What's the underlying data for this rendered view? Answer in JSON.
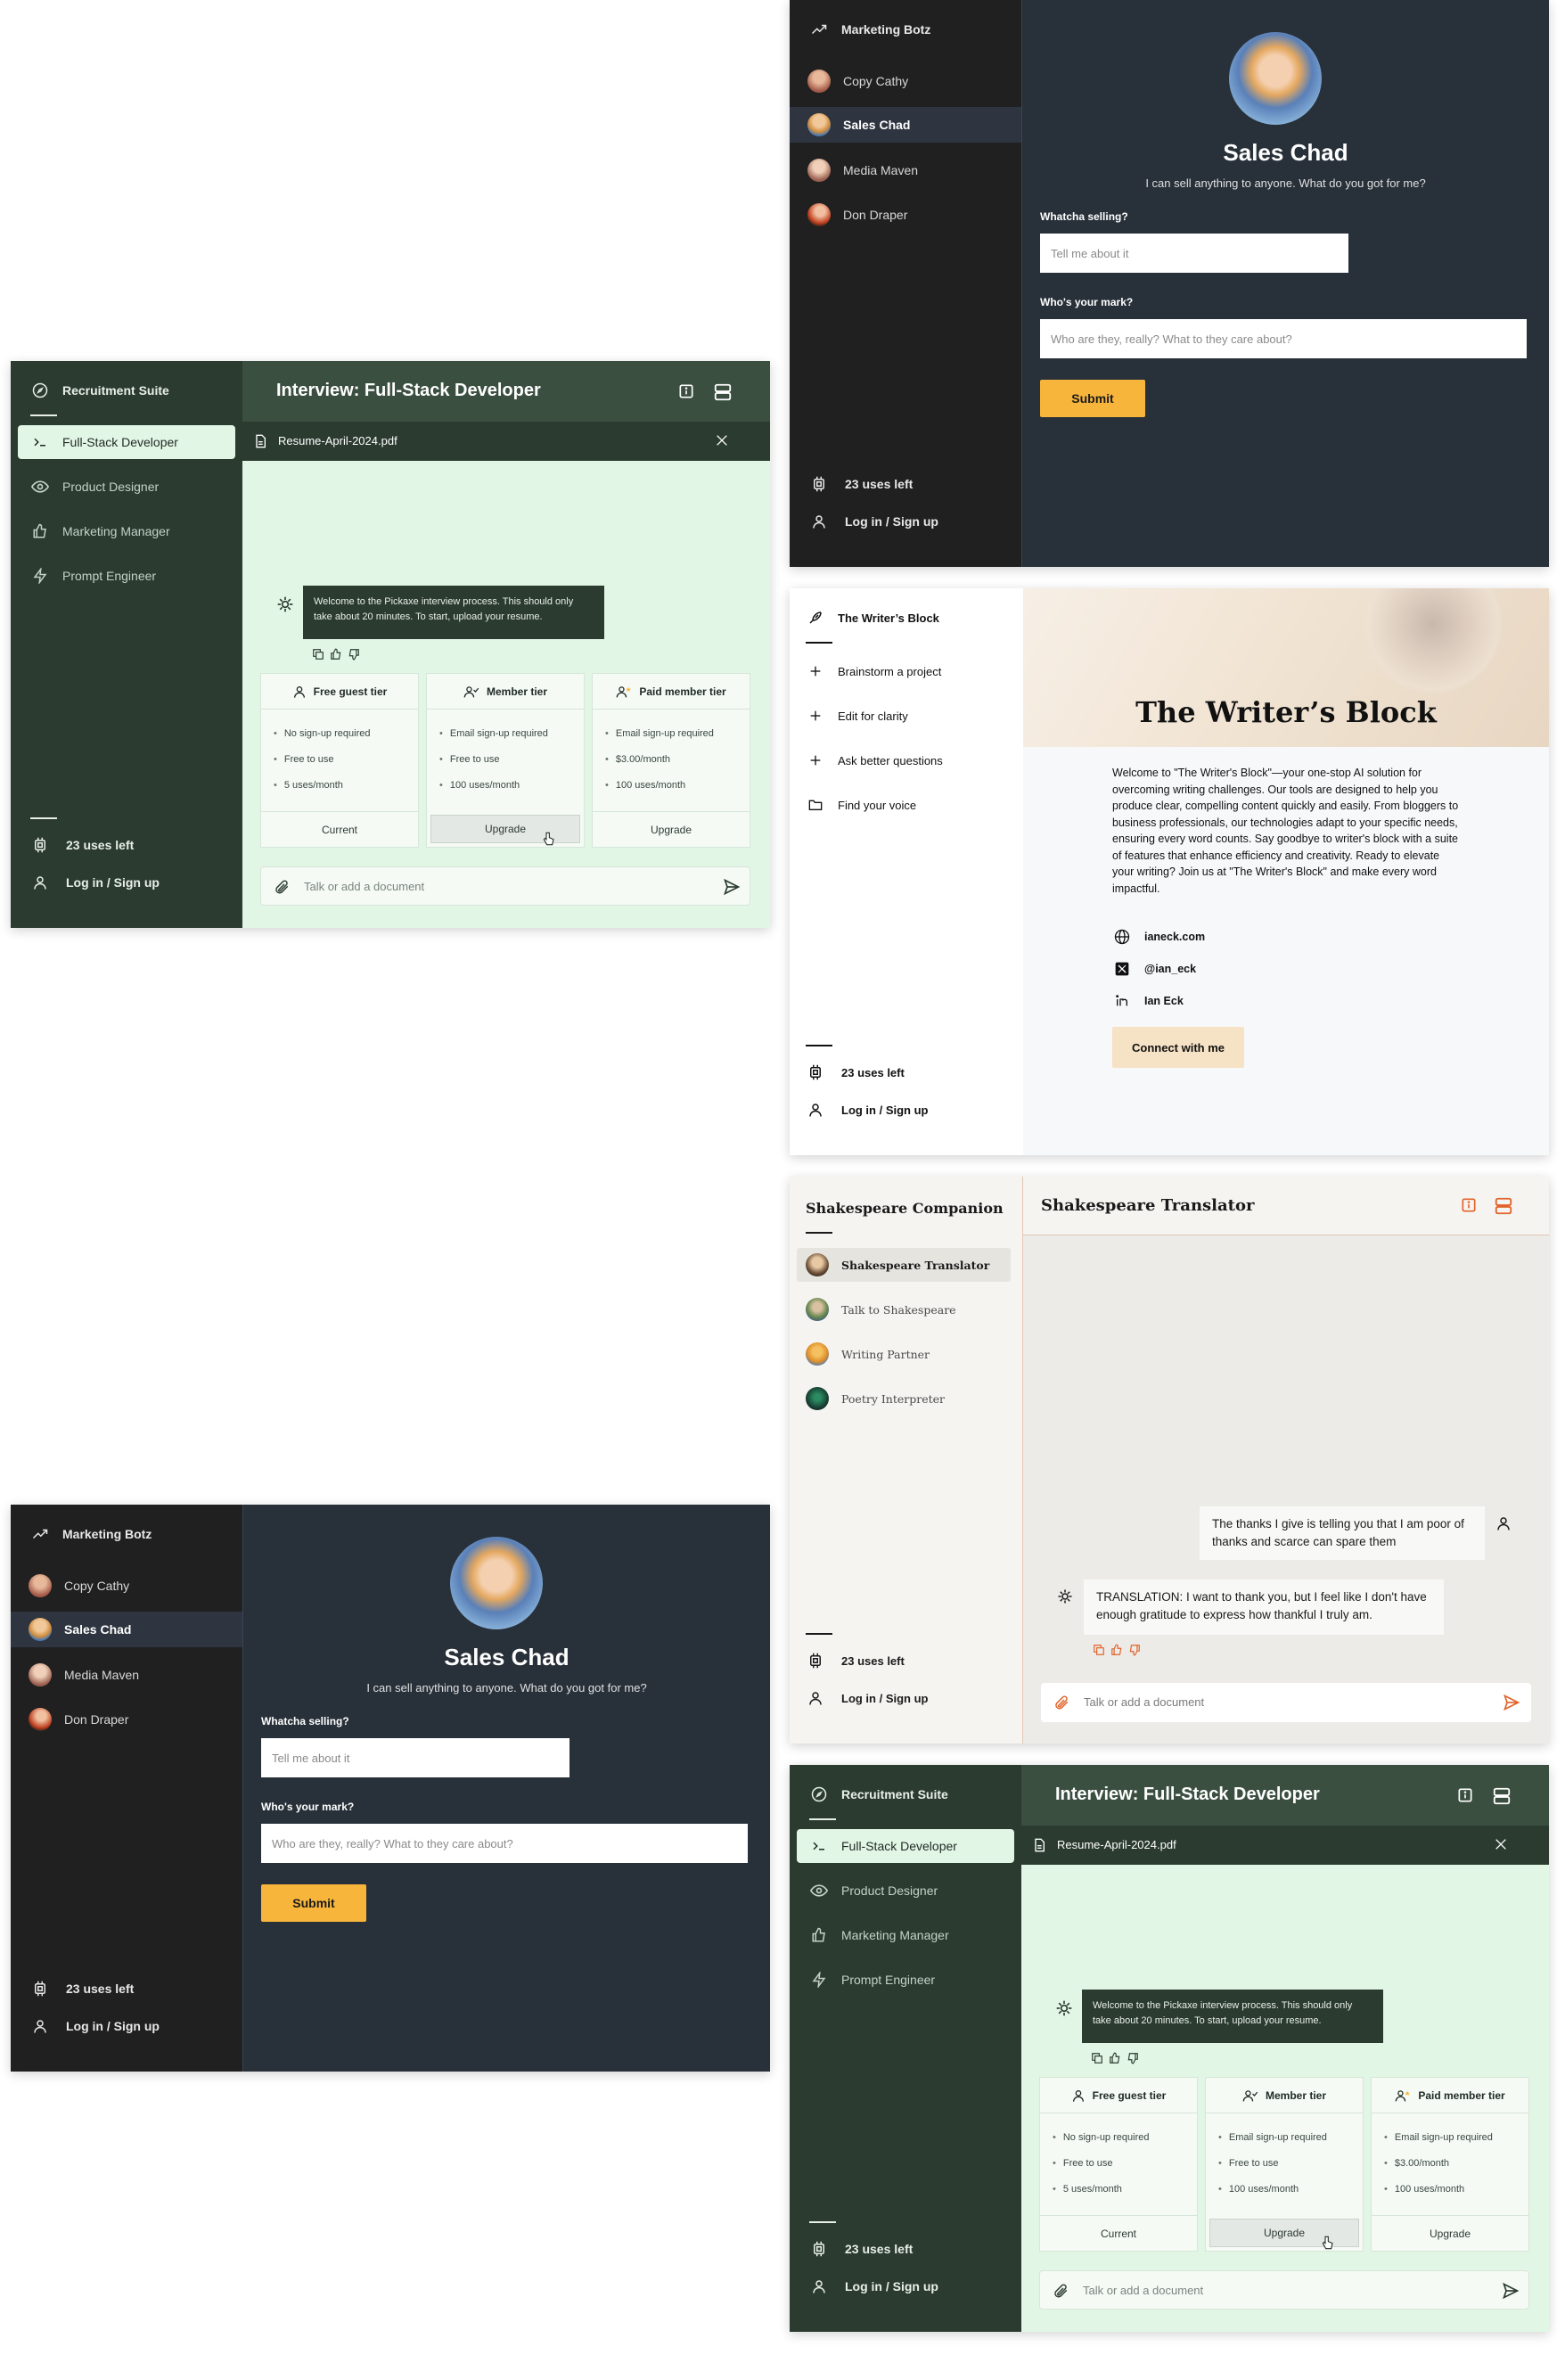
{
  "recruitment": {
    "brand": "Recruitment Suite",
    "items": [
      {
        "label": "Full-Stack Developer"
      },
      {
        "label": "Product Designer"
      },
      {
        "label": "Marketing Manager"
      },
      {
        "label": "Prompt Engineer"
      }
    ],
    "title": "Interview: Full-Stack Developer",
    "file": "Resume-April-2024.pdf",
    "welcome": "Welcome to the Pickaxe interview process. This should only take about 20 minutes. To start, upload your resume.",
    "tiers": [
      {
        "name": "Free guest tier",
        "features": [
          "No sign-up required",
          "Free to use",
          "5 uses/month"
        ],
        "button": "Current"
      },
      {
        "name": "Member tier",
        "features": [
          "Email sign-up required",
          "Free to use",
          "100 uses/month"
        ],
        "button": "Upgrade"
      },
      {
        "name": "Paid member tier",
        "features": [
          "Email sign-up required",
          "$3.00/month",
          "100 uses/month"
        ],
        "button": "Upgrade"
      }
    ],
    "input_placeholder": "Talk or add a document",
    "uses_left": "23 uses left",
    "login": "Log in / Sign up"
  },
  "marketing": {
    "brand": "Marketing Botz",
    "items": [
      {
        "label": "Copy Cathy"
      },
      {
        "label": "Sales Chad"
      },
      {
        "label": "Media Maven"
      },
      {
        "label": "Don Draper"
      }
    ],
    "bot_name": "Sales Chad",
    "tagline": "I can sell anything to anyone. What do you got for me?",
    "q1_label": "Whatcha selling?",
    "q1_placeholder": "Tell me about it",
    "q2_label": "Who's your mark?",
    "q2_placeholder": "Who are they, really? What to they care about?",
    "submit": "Submit",
    "uses_left": "23 uses left",
    "login": "Log in / Sign up"
  },
  "writers": {
    "brand": "The Writer’s Block",
    "items": [
      {
        "label": "Brainstorm a project"
      },
      {
        "label": "Edit for clarity"
      },
      {
        "label": "Ask better questions"
      },
      {
        "label": "Find your voice"
      }
    ],
    "hero_title": "The Writer’s Block",
    "description": "Welcome to \"The Writer's Block\"—your one-stop AI solution for overcoming writing challenges. Our tools are designed to help you produce clear, compelling content quickly and easily. From bloggers to business professionals, our technologies adapt to your specific needs, ensuring every word counts. Say goodbye to writer's block with a suite of features that enhance efficiency and creativity. Ready to elevate your writing? Join us at \"The Writer's Block\" and make every word impactful.",
    "links": [
      {
        "icon": "globe-icon",
        "label": "ianeck.com"
      },
      {
        "icon": "x-logo-icon",
        "label": "@ian_eck"
      },
      {
        "icon": "linkedin-icon",
        "label": "Ian Eck"
      }
    ],
    "connect": "Connect with me",
    "uses_left": "23 uses left",
    "login": "Log in / Sign up"
  },
  "shakespeare": {
    "brand": "Shakespeare Companion",
    "items": [
      {
        "label": "Shakespeare Translator"
      },
      {
        "label": "Talk to Shakespeare"
      },
      {
        "label": "Writing Partner"
      },
      {
        "label": "Poetry Interpreter"
      }
    ],
    "title": "Shakespeare Translator",
    "user_message": "The thanks I give is telling you that I am poor of thanks and scarce can spare them",
    "bot_message": "TRANSLATION: I want to thank you, but I feel like I don't have enough gratitude to express how thankful I truly am.",
    "input_placeholder": "Talk or add a document",
    "uses_left": "23 uses left",
    "login": "Log in / Sign up"
  },
  "colors": {
    "recruit_sidebar": "#2b3b30",
    "recruit_main": "#e2f6e6",
    "marketing_sidebar": "#202020",
    "marketing_main": "#283039",
    "marketing_accent": "#f7b53b",
    "writers_accent": "#f6e2c4",
    "shakespeare_accent": "#e2622a"
  }
}
